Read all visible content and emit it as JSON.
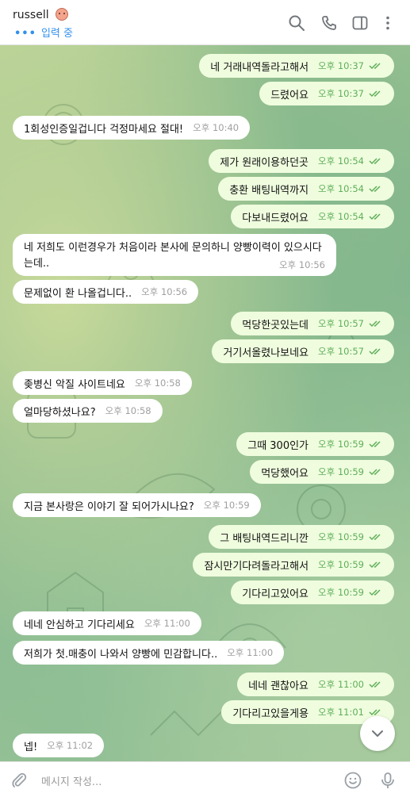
{
  "header": {
    "chat_name": "russell",
    "status": "입력 중",
    "typing_dots": "•••",
    "icons": [
      "search-icon",
      "phone-icon",
      "sidebar-toggle-icon",
      "more-vertical-icon"
    ]
  },
  "composer": {
    "placeholder": "메시지 작성...",
    "icons": [
      "attach-icon",
      "emoji-icon",
      "microphone-icon"
    ]
  },
  "colors": {
    "incoming_bubble": "#ffffff",
    "outgoing_bubble": "#effdde",
    "accent": "#3390ec",
    "read_check": "#5fae5a"
  },
  "messages": [
    {
      "dir": "out",
      "text": "네 거래내역돌라고해서",
      "time": "오후 10:37"
    },
    {
      "dir": "out",
      "text": "드렸어요",
      "time": "오후 10:37"
    },
    {
      "dir": "in",
      "text": "1회성인증일겁니다 걱정마세요 절대!",
      "time": "오후 10:40"
    },
    {
      "dir": "out",
      "text": "제가 원래이용하던곳",
      "time": "오후 10:54"
    },
    {
      "dir": "out",
      "text": "충환 배팅내역까지",
      "time": "오후 10:54"
    },
    {
      "dir": "out",
      "text": "다보내드렸어요",
      "time": "오후 10:54"
    },
    {
      "dir": "in",
      "text": "네 저희도 이런경우가 처음이라 본사에 문의하니 양빵이력이 있으시다는데..",
      "time": "오후 10:56"
    },
    {
      "dir": "in",
      "text": "문제없이 환 나올겁니다..",
      "time": "오후 10:56"
    },
    {
      "dir": "out",
      "text": "먹당한곳있는데",
      "time": "오후 10:57"
    },
    {
      "dir": "out",
      "text": "거기서올렸나보네요",
      "time": "오후 10:57"
    },
    {
      "dir": "in",
      "text": "좆병신 악질 사이트네요",
      "time": "오후 10:58"
    },
    {
      "dir": "in",
      "text": "얼마당하셨나요?",
      "time": "오후 10:58"
    },
    {
      "dir": "out",
      "text": "그때 300인가",
      "time": "오후 10:59"
    },
    {
      "dir": "out",
      "text": "먹당했어요",
      "time": "오후 10:59"
    },
    {
      "dir": "in",
      "text": "지금 본사랑은 이야기 잘 되어가시나요?",
      "time": "오후 10:59"
    },
    {
      "dir": "out",
      "text": "그 배팅내역드리니깐",
      "time": "오후 10:59"
    },
    {
      "dir": "out",
      "text": "잠시만기다려돌라고해서",
      "time": "오후 10:59"
    },
    {
      "dir": "out",
      "text": "기다리고있어요",
      "time": "오후 10:59"
    },
    {
      "dir": "in",
      "text": "네네 안심하고 기다리세요",
      "time": "오후 11:00"
    },
    {
      "dir": "in",
      "text": "저희가 첫.매충이 나와서 양빵에 민감합니다..",
      "time": "오후 11:00"
    },
    {
      "dir": "out",
      "text": "네네 괜찮아요",
      "time": "오후 11:00"
    },
    {
      "dir": "out",
      "text": "기다리고있을게용",
      "time": "오후 11:01"
    },
    {
      "dir": "in",
      "text": "넵!",
      "time": "오후 11:02"
    }
  ]
}
